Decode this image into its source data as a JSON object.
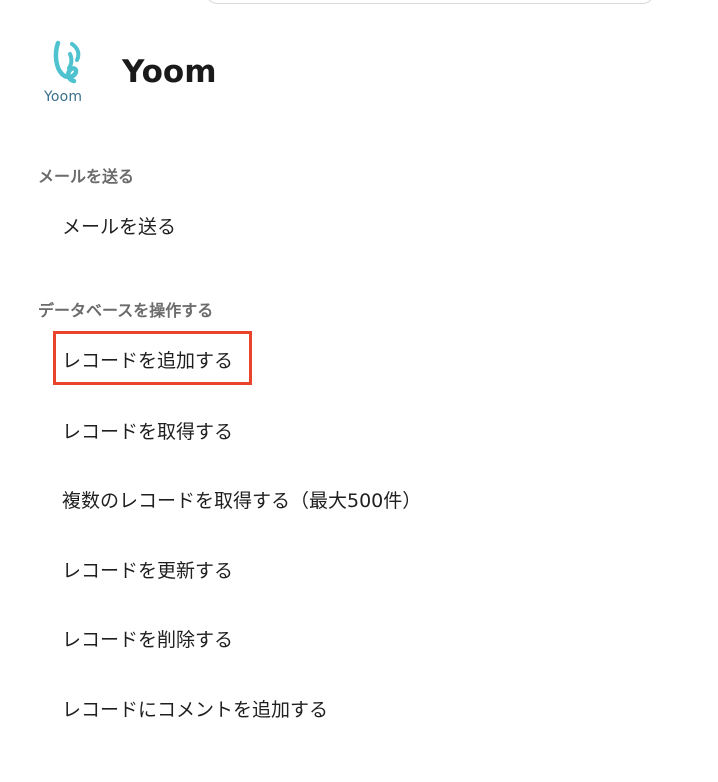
{
  "app": {
    "logo_text": "Yoom",
    "title": "Yoom"
  },
  "sections": [
    {
      "heading": "メールを送る",
      "actions": [
        "メールを送る"
      ]
    },
    {
      "heading": "データベースを操作する",
      "actions": [
        "レコードを追加する",
        "レコードを取得する",
        "複数のレコードを取得する（最大500件）",
        "レコードを更新する",
        "レコードを削除する",
        "レコードにコメントを追加する"
      ]
    }
  ],
  "highlighted_action": "レコードを追加する",
  "colors": {
    "highlight": "#e8452c",
    "logo": "#4ec3cf"
  },
  "icons": {
    "logo": "yoom-logo-icon"
  }
}
